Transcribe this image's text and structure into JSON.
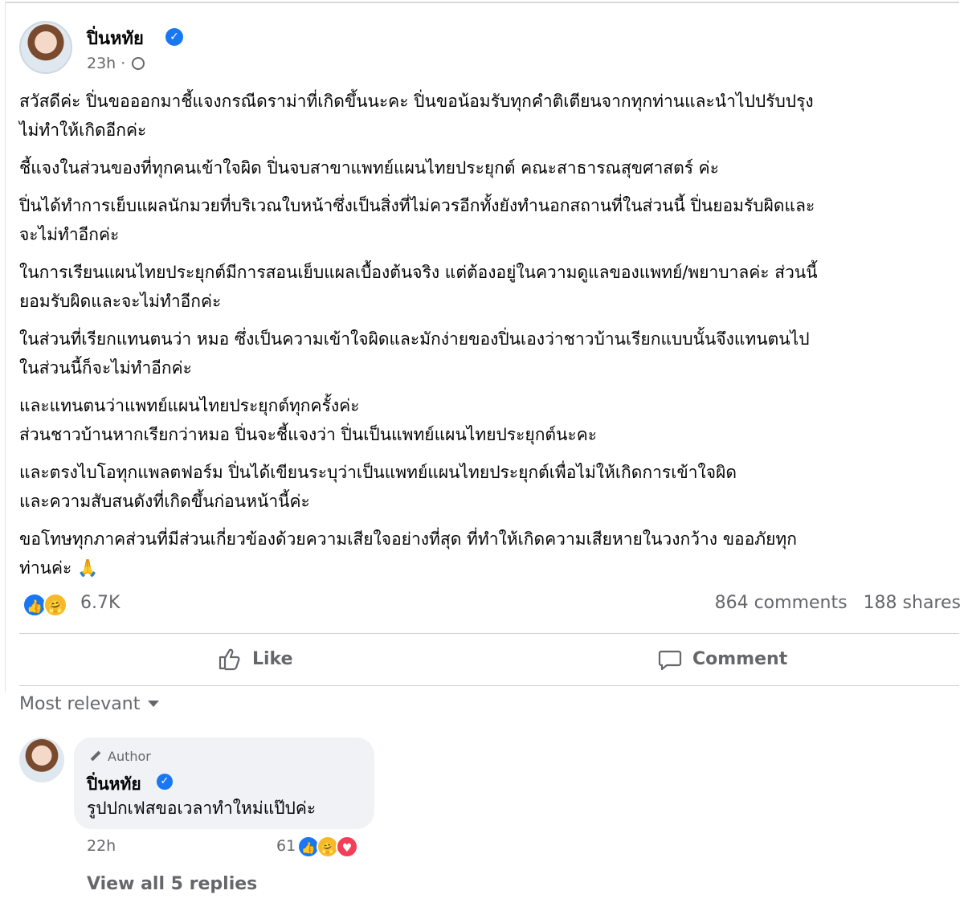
{
  "post": {
    "author": "ปิ่นหทัย",
    "time": "23h",
    "icons": {
      "verified": "verified-check-icon",
      "privacy": "globe-icon"
    },
    "paragraphs": [
      "สวัสดีค่ะ ปิ่นขอออกมาชี้แจงกรณีดราม่าที่เกิดขึ้นนะคะ ปิ่นขอน้อมรับทุกคำติเตียนจากทุกท่านและนำไปปรับปรุง\nไม่ทำให้เกิดอีกค่ะ",
      " ชี้แจงในส่วนของที่ทุกคนเข้าใจผิด ปิ่นจบสาขาแพทย์แผนไทยประยุกต์ คณะสาธารณสุขศาสตร์ ค่ะ",
      "ปิ่นได้ทำการเย็บแผลนักมวยที่บริเวณใบหน้าซึ่งเป็นสิ่งที่ไม่ควรอีกทั้งยังทำนอกสถานที่ในส่วนนี้ ปิ่นยอมรับผิดและ\nจะไม่ทำอีกค่ะ",
      "ในการเรียนแผนไทยประยุกต์มีการสอนเย็บแผลเบื้องต้นจริง แต่ต้องอยู่ในความดูแลของแพทย์/พยาบาลค่ะ ส่วนนี้\nยอมรับผิดและจะไม่ทำอีกค่ะ",
      "ในส่วนที่เรียกแทนตนว่า หมอ ซึ่งเป็นความเข้าใจผิดและมักง่ายของปิ่นเองว่าชาวบ้านเรียกแบบนั้นจึงแทนตนไป\nในส่วนนี้ก็จะไม่ทำอีกค่ะ",
      "และแทนตนว่าแพทย์แผนไทยประยุกต์ทุกครั้งค่ะ\nส่วนชาวบ้านหากเรียกว่าหมอ ปิ่นจะชี้แจงว่า ปิ่นเป็นแพทย์แผนไทยประยุกต์นะคะ",
      "และตรงไบโอทุกแพลตฟอร์ม ปิ่นได้เขียนระบุว่าเป็นแพทย์แผนไทยประยุกต์เพื่อไม่ให้เกิดการเข้าใจผิด\nและความสับสนดังที่เกิดขึ้นก่อนหน้านี้ค่ะ",
      "ขอโทษทุกภาคส่วนที่มีส่วนเกี่ยวข้องด้วยความเสียใจอย่างที่สุด ที่ทำให้เกิดความเสียหายในวงกว้าง ขออภัยทุก\nท่านค่ะ 🙏"
    ],
    "reactions_count": "6.7K",
    "comments_count": "864 comments",
    "shares_count": "188 shares"
  },
  "actions": {
    "like_label": "Like",
    "comment_label": "Comment"
  },
  "comments_section": {
    "sort_label": "Most relevant",
    "comment": {
      "badge": "Author",
      "author": "ปิ่นหทัย",
      "text": "รูปปกเฟสขอเวลาทำใหม่แป๊ปค่ะ",
      "time": "22h",
      "reactions_count": "61",
      "view_replies_label": "View all 5 replies"
    }
  },
  "colors": {
    "accent": "#1877f2",
    "secondary_text": "#65676b",
    "bubble_bg": "#f0f2f5"
  }
}
